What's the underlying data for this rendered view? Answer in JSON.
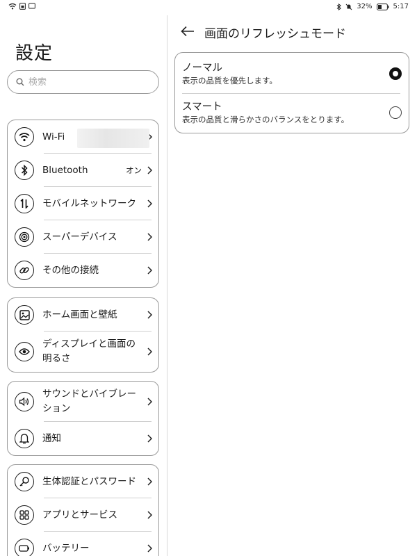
{
  "status_bar": {
    "battery": "32%",
    "time": "5:17"
  },
  "settings": {
    "title": "設定",
    "search_placeholder": "検索",
    "groups": [
      {
        "items": [
          {
            "label": "Wi-Fi",
            "icon": "wifi-icon",
            "value": ""
          },
          {
            "label": "Bluetooth",
            "icon": "bluetooth-icon",
            "value": "オン"
          },
          {
            "label": "モバイルネットワーク",
            "icon": "mobile-network-icon",
            "value": ""
          },
          {
            "label": "スーパーデバイス",
            "icon": "super-device-icon",
            "value": ""
          },
          {
            "label": "その他の接続",
            "icon": "link-icon",
            "value": ""
          }
        ]
      },
      {
        "items": [
          {
            "label": "ホーム画面と壁紙",
            "icon": "wallpaper-icon"
          },
          {
            "label": "ディスプレイと画面の明るさ",
            "label_lines": [
              "ディスプレイと画面の",
              "明るさ"
            ],
            "icon": "eye-icon"
          }
        ]
      },
      {
        "items": [
          {
            "label": "サウンドとバイブレーション",
            "label_lines": [
              "サウンドとバイブレー",
              "ション"
            ],
            "icon": "speaker-icon"
          },
          {
            "label": "通知",
            "icon": "bell-icon"
          }
        ]
      },
      {
        "items": [
          {
            "label": "生体認証とパスワード",
            "icon": "key-icon"
          },
          {
            "label": "アプリとサービス",
            "icon": "apps-grid-icon"
          },
          {
            "label": "バッテリー",
            "icon": "battery-icon"
          }
        ]
      }
    ]
  },
  "refresh": {
    "title": "画面のリフレッシュモード",
    "options": [
      {
        "title": "ノーマル",
        "description": "表示の品質を優先します。",
        "selected": true
      },
      {
        "title": "スマート",
        "description": "表示の品質と滑らかさのバランスをとります。",
        "selected": false
      }
    ]
  }
}
